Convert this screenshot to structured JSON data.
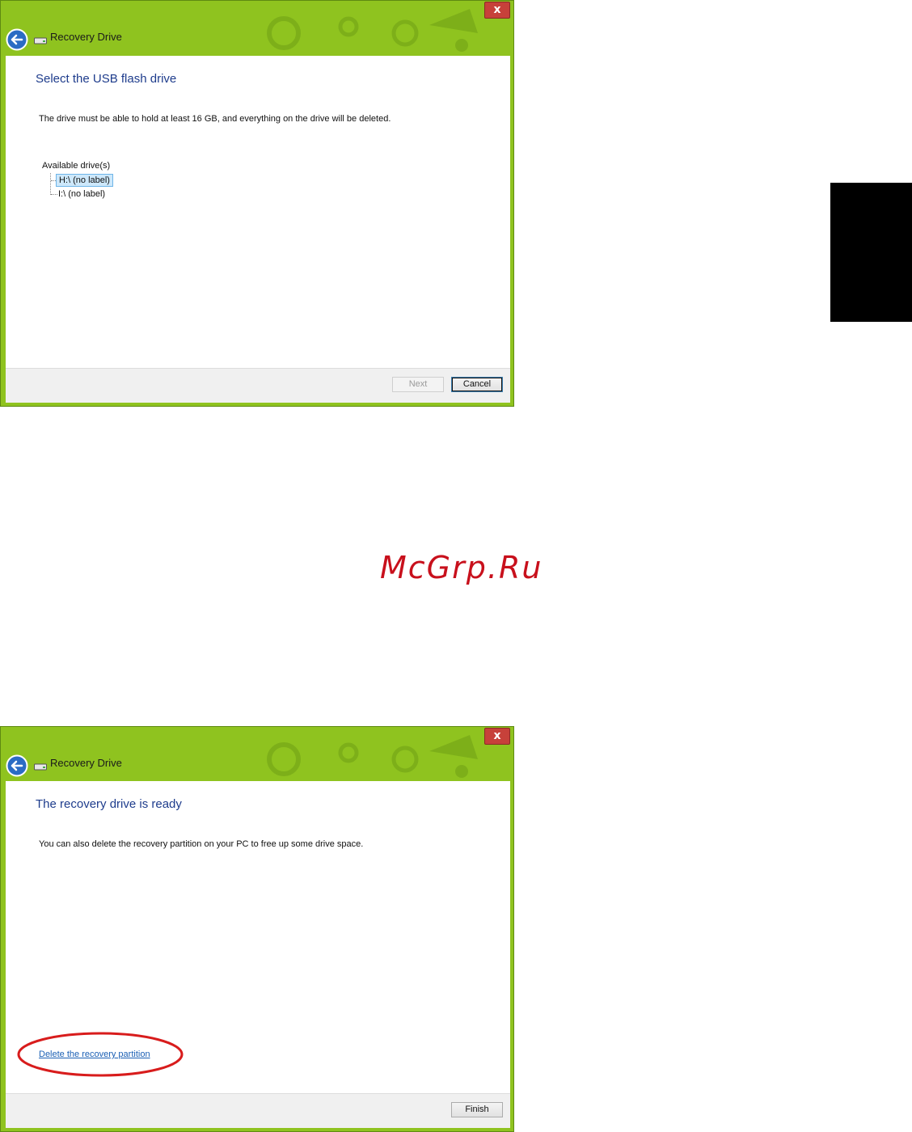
{
  "window_top": {
    "title": "Recovery Drive",
    "close_label": "x",
    "heading": "Select the USB flash drive",
    "description": "The drive must be able to hold at least 16 GB, and everything on the drive will be deleted.",
    "drives_label": "Available drive(s)",
    "drives": [
      {
        "label": "H:\\ (no label)",
        "selected": true
      },
      {
        "label": "I:\\ (no label)",
        "selected": false
      }
    ],
    "next_label": "Next",
    "cancel_label": "Cancel"
  },
  "window_bottom": {
    "title": "Recovery Drive",
    "close_label": "x",
    "heading": "The recovery drive is ready",
    "description": "You can also delete the recovery partition on your PC to free up some drive space.",
    "delete_link": "Delete the recovery partition",
    "finish_label": "Finish"
  },
  "watermark": "McGrp.Ru",
  "colors": {
    "title_bar": "#8fc31f",
    "heading": "#1e3c8c",
    "link": "#1a5fb4",
    "highlight": "#d81c1c",
    "close": "#c7413a"
  }
}
